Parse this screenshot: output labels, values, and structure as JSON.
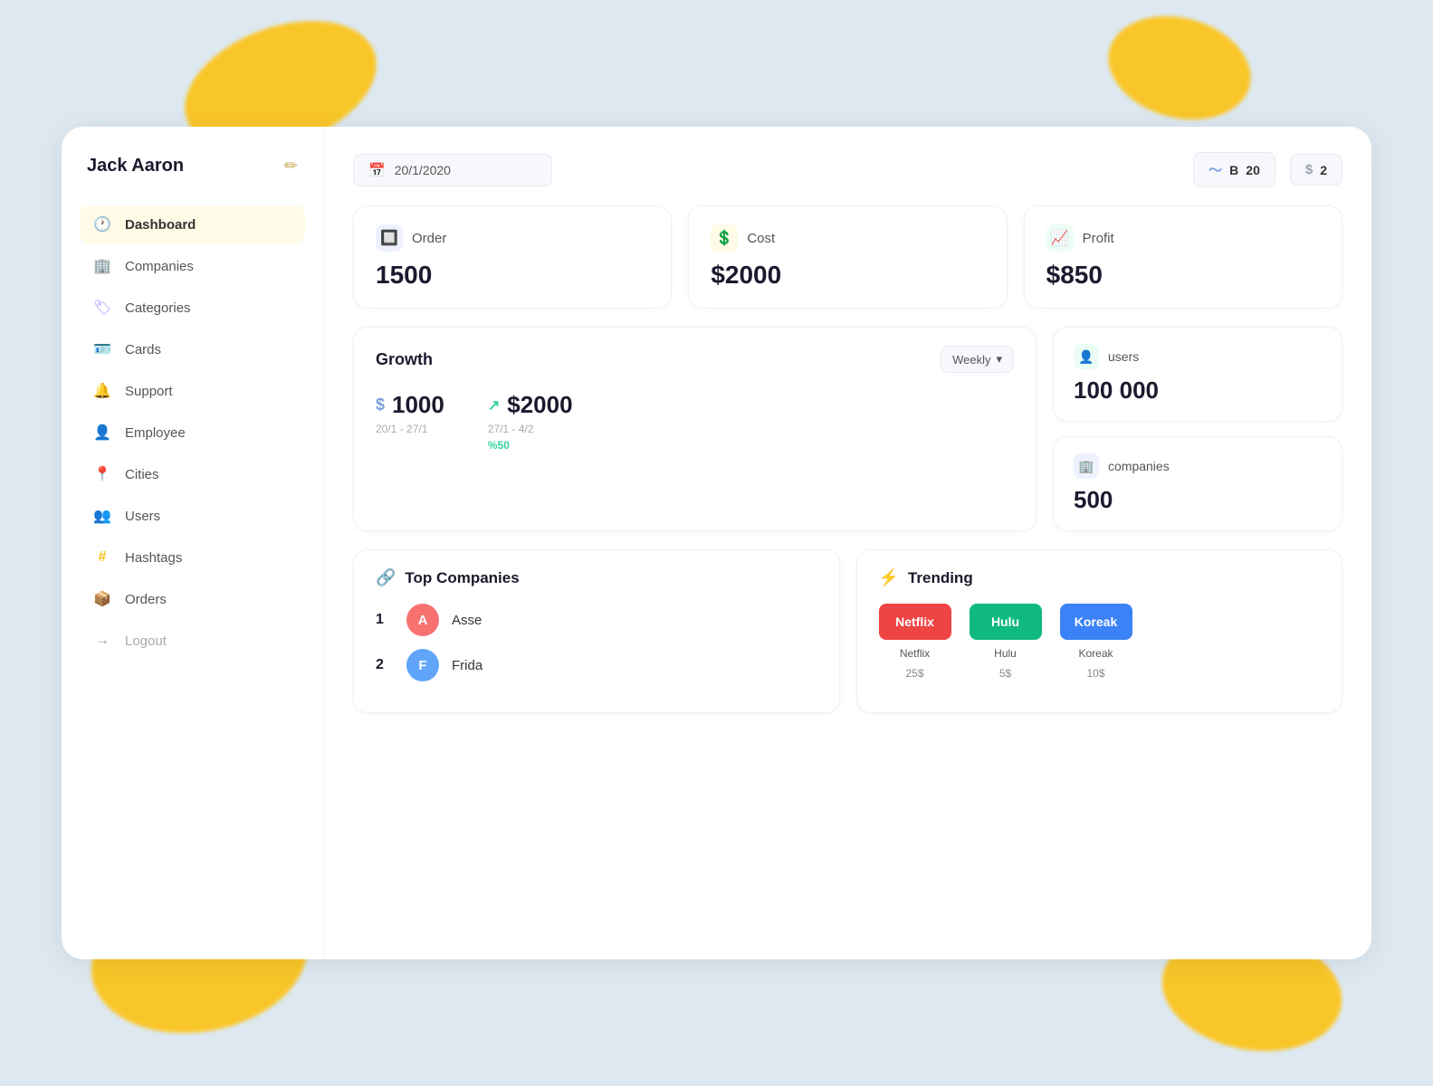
{
  "background": {
    "color": "#dde8f0"
  },
  "sidebar": {
    "user_name": "Jack Aaron",
    "edit_icon": "✏",
    "items": [
      {
        "id": "dashboard",
        "label": "Dashboard",
        "icon": "🕐",
        "icon_class": "yellow",
        "active": true
      },
      {
        "id": "companies",
        "label": "Companies",
        "icon": "🏢",
        "icon_class": "blue",
        "active": false
      },
      {
        "id": "categories",
        "label": "Categories",
        "icon": "🏷",
        "icon_class": "purple",
        "active": false
      },
      {
        "id": "cards",
        "label": "Cards",
        "icon": "🪪",
        "icon_class": "blue",
        "active": false
      },
      {
        "id": "support",
        "label": "Support",
        "icon": "🔔",
        "icon_class": "yellow",
        "active": false
      },
      {
        "id": "employee",
        "label": "Employee",
        "icon": "👤",
        "icon_class": "blue",
        "active": false
      },
      {
        "id": "cities",
        "label": "Cities",
        "icon": "📍",
        "icon_class": "yellow",
        "active": false
      },
      {
        "id": "users",
        "label": "Users",
        "icon": "👥",
        "icon_class": "blue",
        "active": false
      },
      {
        "id": "hashtags",
        "label": "Hashtags",
        "icon": "#",
        "icon_class": "yellow",
        "active": false
      },
      {
        "id": "orders",
        "label": "Orders",
        "icon": "📦",
        "icon_class": "blue",
        "active": false
      },
      {
        "id": "logout",
        "label": "Logout",
        "icon": "→",
        "icon_class": "gray",
        "active": false
      }
    ]
  },
  "header": {
    "date": "20/1/2020",
    "date_icon": "📅",
    "badge1_icon": "〜",
    "badge1_label": "B",
    "badge1_value": "20",
    "badge2_icon": "$",
    "badge2_value": "2"
  },
  "stats": [
    {
      "id": "order",
      "label": "Order",
      "value": "1500",
      "icon": "🔲",
      "icon_class": "blue-bg"
    },
    {
      "id": "cost",
      "label": "Cost",
      "value": "$2000",
      "icon": "💲",
      "icon_class": "yellow-bg"
    },
    {
      "id": "profit",
      "label": "Profit",
      "value": "$850",
      "icon": "📈",
      "icon_class": "green-bg"
    }
  ],
  "growth": {
    "title": "Growth",
    "select_label": "Weekly",
    "items": [
      {
        "amount": "$1000",
        "has_icon": true,
        "icon_type": "dollar",
        "date": "20/1 - 27/1"
      },
      {
        "amount": "$2000",
        "has_icon": true,
        "icon_type": "arrow",
        "date": "27/1 - 4/2",
        "percent": "%50"
      }
    ]
  },
  "right_stats": [
    {
      "id": "users",
      "label": "users",
      "value": "100 000",
      "icon": "👤",
      "icon_class": "green-bg"
    },
    {
      "id": "companies",
      "label": "companies",
      "value": "500",
      "icon": "🏢",
      "icon_class": "blue-bg"
    }
  ],
  "top_companies": {
    "title": "Top Companies",
    "icon": "🔗",
    "items": [
      {
        "rank": "1",
        "name": "Asse",
        "avatar_letter": "A",
        "avatar_class": "pink"
      },
      {
        "rank": "2",
        "name": "Frida",
        "avatar_letter": "F",
        "avatar_class": "blue"
      }
    ]
  },
  "trending": {
    "title": "Trending",
    "icon": "⚡",
    "items": [
      {
        "label": "Netflix",
        "name": "Netflix",
        "price": "25$",
        "badge_class": "red"
      },
      {
        "label": "Hulu",
        "name": "Hulu",
        "price": "5$",
        "badge_class": "green"
      },
      {
        "label": "Koreak",
        "name": "Koreak",
        "price": "10$",
        "badge_class": "blue"
      }
    ]
  }
}
